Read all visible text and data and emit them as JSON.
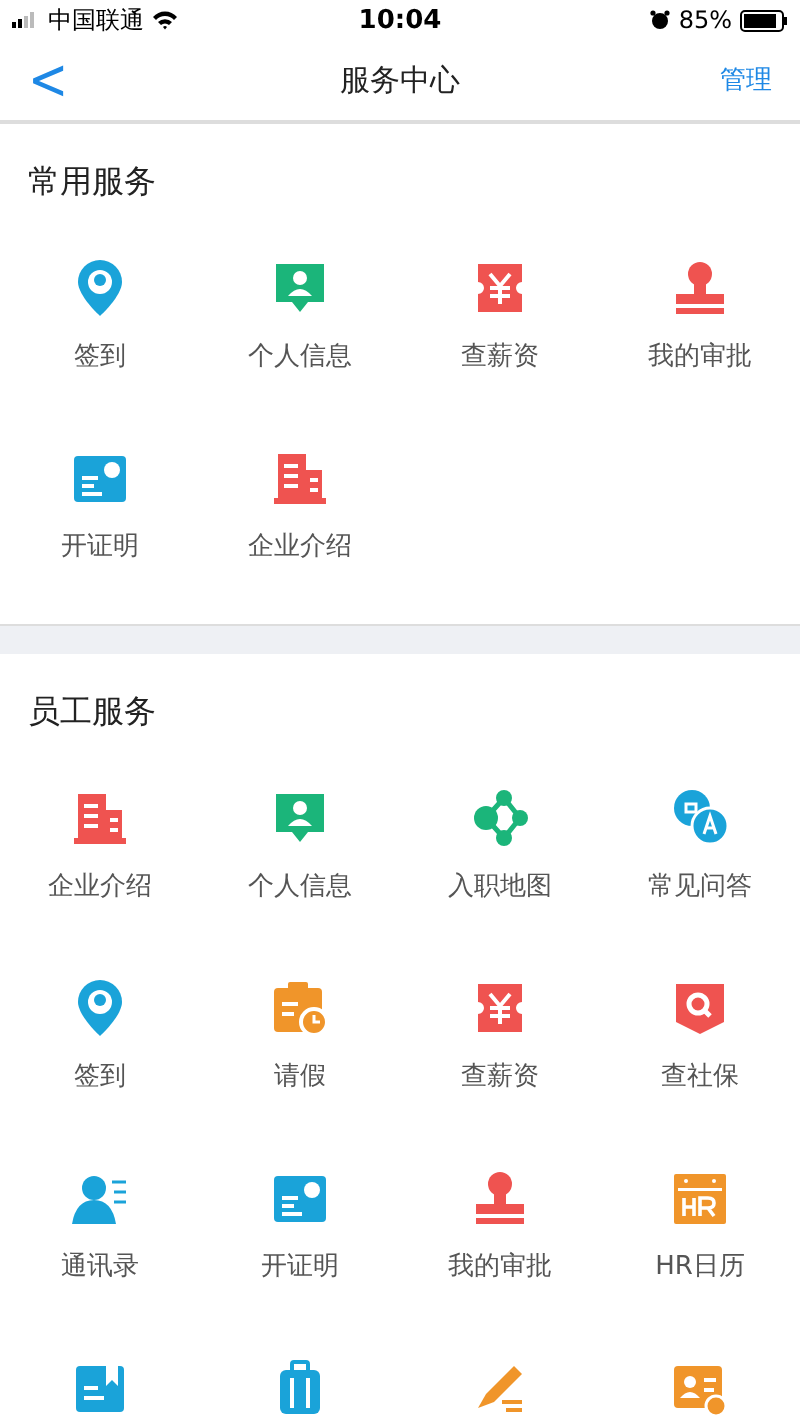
{
  "status_bar": {
    "carrier": "中国联通",
    "time": "10:04",
    "battery": "85%"
  },
  "nav": {
    "back": "<",
    "title": "服务中心",
    "action": "管理"
  },
  "sections": [
    {
      "title": "常用服务",
      "items": [
        {
          "kind": "pin",
          "color": "#1aa3d9",
          "label": "签到"
        },
        {
          "kind": "chat-person",
          "color": "#1bb57a",
          "label": "个人信息"
        },
        {
          "kind": "yen",
          "color": "#ef5350",
          "label": "查薪资"
        },
        {
          "kind": "stamp",
          "color": "#ef5350",
          "label": "我的审批"
        },
        {
          "kind": "certificate",
          "color": "#1aa3d9",
          "label": "开证明"
        },
        {
          "kind": "building",
          "color": "#ef5350",
          "label": "企业介绍"
        }
      ]
    },
    {
      "title": "员工服务",
      "items": [
        {
          "kind": "building",
          "color": "#ef5350",
          "label": "企业介绍"
        },
        {
          "kind": "chat-person",
          "color": "#1bb57a",
          "label": "个人信息"
        },
        {
          "kind": "network",
          "color": "#1bb57a",
          "label": "入职地图"
        },
        {
          "kind": "qa",
          "color": "#1aa3d9",
          "label": "常见问答"
        },
        {
          "kind": "pin",
          "color": "#1aa3d9",
          "label": "签到"
        },
        {
          "kind": "calendar-clock",
          "color": "#f0952a",
          "label": "请假"
        },
        {
          "kind": "yen",
          "color": "#ef5350",
          "label": "查薪资"
        },
        {
          "kind": "search-shield",
          "color": "#ef5350",
          "label": "查社保"
        },
        {
          "kind": "contacts",
          "color": "#1aa3d9",
          "label": "通讯录"
        },
        {
          "kind": "certificate",
          "color": "#1aa3d9",
          "label": "开证明"
        },
        {
          "kind": "stamp",
          "color": "#ef5350",
          "label": "我的审批"
        },
        {
          "kind": "hr-calendar",
          "color": "#f0952a",
          "label": "HR日历"
        },
        {
          "kind": "bookmark-doc",
          "color": "#1aa3d9"
        },
        {
          "kind": "luggage",
          "color": "#1aa3d9"
        },
        {
          "kind": "pencil",
          "color": "#f0952a"
        },
        {
          "kind": "card-person",
          "color": "#f0952a"
        }
      ]
    }
  ]
}
